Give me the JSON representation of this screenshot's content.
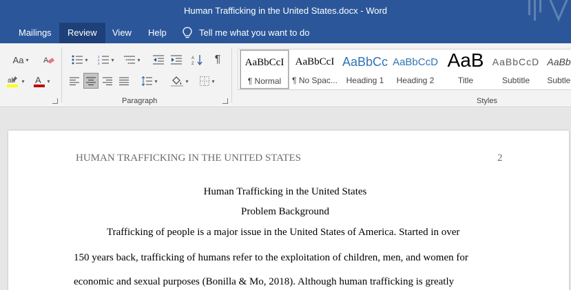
{
  "window": {
    "title": "Human Trafficking in the United States.docx  -  Word"
  },
  "tabs": [
    {
      "label": "Mailings"
    },
    {
      "label": "Review",
      "active": true
    },
    {
      "label": "View"
    },
    {
      "label": "Help"
    }
  ],
  "tell_me": {
    "text": "Tell me what you want to do"
  },
  "ribbon": {
    "font_group": {
      "aa_label": "Aa"
    },
    "paragraph_group": {
      "label": "Paragraph"
    },
    "styles_group": {
      "label": "Styles",
      "items": [
        {
          "preview": "AaBbCcI",
          "name": "¶ Normal",
          "selected": true
        },
        {
          "preview": "AaBbCcI",
          "name": "¶ No Spac..."
        },
        {
          "preview": "AaBbCc",
          "name": "Heading 1"
        },
        {
          "preview": "AaBbCcD",
          "name": "Heading 2"
        },
        {
          "preview": "AaB",
          "name": "Title"
        },
        {
          "preview": "AaBbCcD",
          "name": "Subtitle"
        },
        {
          "preview": "AaBbCcI",
          "name": "Subtle Em"
        }
      ]
    }
  },
  "document": {
    "running_head": "HUMAN TRAFFICKING IN THE UNITED STATES",
    "page_number": "2",
    "title": "Human Trafficking in the United States",
    "section_heading": "Problem Background",
    "body_lines": [
      "Trafficking of people is a major issue in the United States of America. Started in over",
      "150 years back, trafficking of humans refer to the exploitation of children, men, and women for",
      "economic and sexual purposes (Bonilla & Mo, 2018). Although human trafficking is greatly"
    ]
  },
  "colors": {
    "title_bar": "#2b579a",
    "ribbon": "#f3f3f3",
    "heading_blue": "#2e74b5",
    "font_color_red": "#c00000",
    "highlight_yellow": "#ffff00"
  }
}
